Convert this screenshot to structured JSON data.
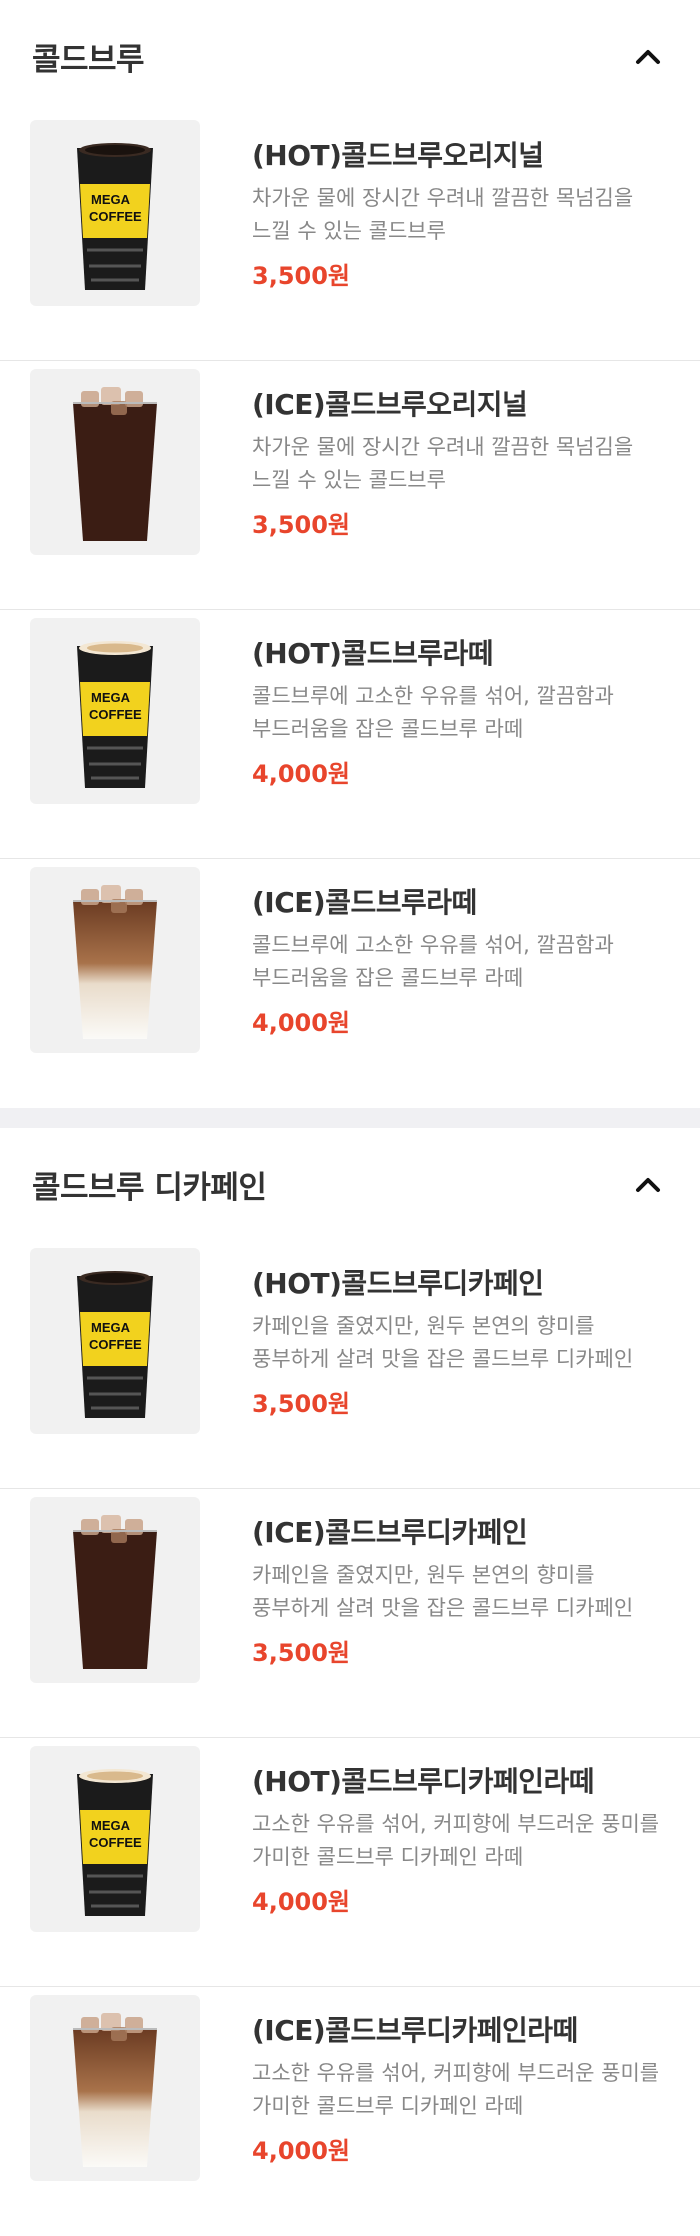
{
  "sections": [
    {
      "title": "콜드브루",
      "icon": "chevron-up-icon",
      "items": [
        {
          "name": "(HOT)콜드브루오리지널",
          "desc": "차가운 물에 장시간 우려내 깔끔한 목넘김을 느낄 수 있는 콜드브루",
          "price": "3,500원",
          "image": "hot-black-cup"
        },
        {
          "name": "(ICE)콜드브루오리지널",
          "desc": "차가운 물에 장시간 우려내 깔끔한 목넘김을 느낄 수 있는 콜드브루",
          "price": "3,500원",
          "image": "ice-black-cup"
        },
        {
          "name": "(HOT)콜드브루라떼",
          "desc": "콜드브루에 고소한 우유를 섞어, 깔끔함과 부드러움을 잡은 콜드브루 라떼",
          "price": "4,000원",
          "image": "hot-latte-cup"
        },
        {
          "name": "(ICE)콜드브루라떼",
          "desc": "콜드브루에 고소한 우유를 섞어, 깔끔함과 부드러움을 잡은 콜드브루 라떼",
          "price": "4,000원",
          "image": "ice-latte-cup"
        }
      ]
    },
    {
      "title": "콜드브루 디카페인",
      "icon": "chevron-up-icon",
      "items": [
        {
          "name": "(HOT)콜드브루디카페인",
          "desc": "카페인을 줄였지만, 원두 본연의 향미를 풍부하게 살려 맛을 잡은 콜드브루 디카페인",
          "price": "3,500원",
          "image": "hot-black-cup"
        },
        {
          "name": "(ICE)콜드브루디카페인",
          "desc": "카페인을 줄였지만, 원두 본연의 향미를 풍부하게 살려 맛을 잡은 콜드브루 디카페인",
          "price": "3,500원",
          "image": "ice-black-cup"
        },
        {
          "name": "(HOT)콜드브루디카페인라떼",
          "desc": "고소한 우유를 섞어, 커피향에 부드러운 풍미를 가미한 콜드브루 디카페인 라떼",
          "price": "4,000원",
          "image": "hot-latte-cup"
        },
        {
          "name": "(ICE)콜드브루디카페인라떼",
          "desc": "고소한 우유를 섞어, 커피향에 부드러운 풍미를 가미한 콜드브루 디카페인 라떼",
          "price": "4,000원",
          "image": "ice-latte-cup"
        }
      ]
    }
  ],
  "cup_logo": {
    "line1": "MEGA",
    "line2": "COFFEE"
  },
  "colors": {
    "price": "#e8452c",
    "band": "#f0f0f3",
    "cup_yellow": "#f2d21e"
  }
}
